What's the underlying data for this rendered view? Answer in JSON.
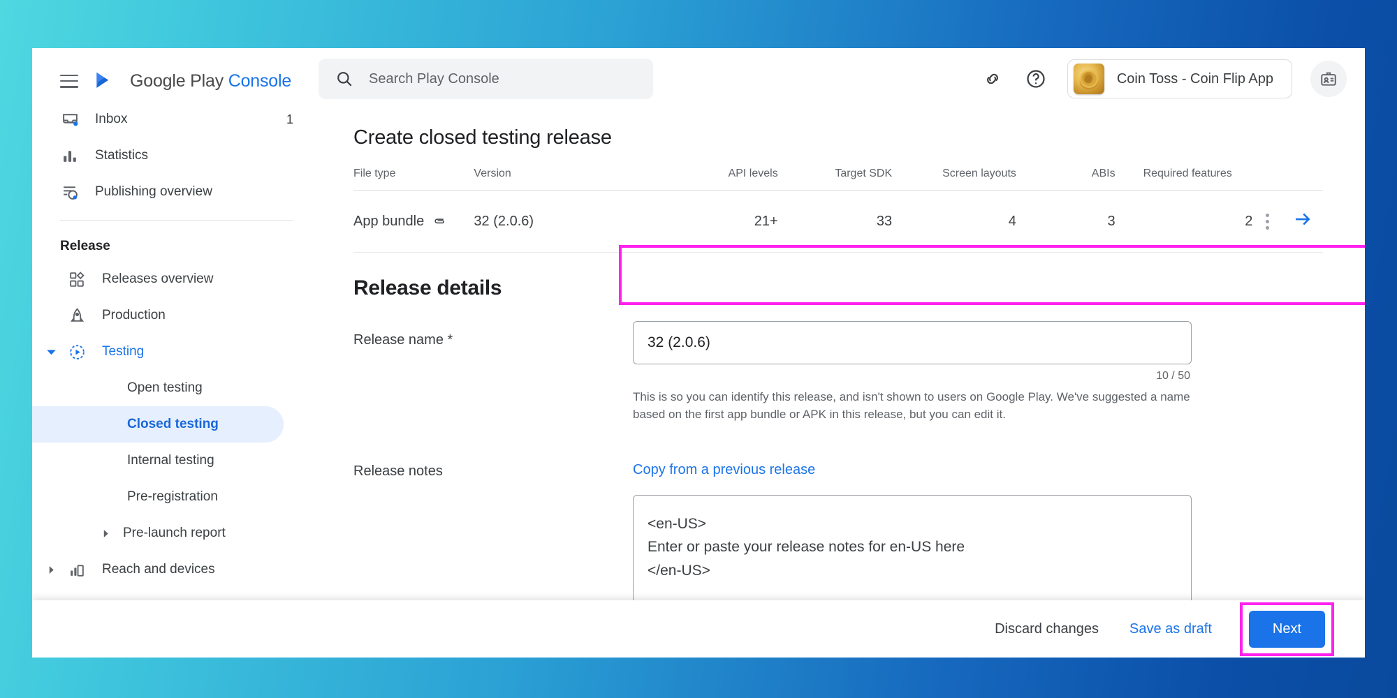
{
  "sidebar": {
    "brand": {
      "part1": "Google Play",
      "part2": "Console",
      "logo_icon": "play-console-logo-icon",
      "menu_icon": "hamburger-menu-icon"
    },
    "top_items": [
      {
        "label": "Inbox",
        "count": "1",
        "icon": "inbox-icon"
      },
      {
        "label": "Statistics",
        "count": "",
        "icon": "bar-chart-icon"
      },
      {
        "label": "Publishing overview",
        "count": "",
        "icon": "publishing-overview-icon"
      }
    ],
    "section_label": "Release",
    "release_items": [
      {
        "label": "Releases overview",
        "icon": "dashboard-grid-icon"
      },
      {
        "label": "Production",
        "icon": "rocket-icon"
      },
      {
        "label": "Testing",
        "icon": "testing-play-icon"
      }
    ],
    "testing_children": [
      {
        "label": "Open testing"
      },
      {
        "label": "Closed testing"
      },
      {
        "label": "Internal testing"
      },
      {
        "label": "Pre-registration"
      },
      {
        "label": "Pre-launch report"
      }
    ],
    "reach_and_devices": {
      "label": "Reach and devices",
      "icon": "reach-devices-chart-icon"
    }
  },
  "topbar": {
    "search": {
      "placeholder": "Search Play Console",
      "value": "",
      "icon": "search-icon"
    },
    "link_icon": "link-icon",
    "help_icon": "help-circle-icon",
    "app_chip": {
      "name": "Coin Toss - Coin Flip App",
      "avatar_icon": "coin-avatar-icon"
    },
    "badge_icon": "id-badge-icon"
  },
  "page": {
    "title": "Create closed testing release"
  },
  "bundle_table": {
    "columns": [
      "File type",
      "Version",
      "API levels",
      "Target SDK",
      "Screen layouts",
      "ABIs",
      "Required features"
    ],
    "rows": [
      {
        "file_type": "App bundle",
        "file_type_icon": "attachment-icon",
        "version": "32 (2.0.6)",
        "api_levels": "21+",
        "target_sdk": "33",
        "screen_layouts": "4",
        "abis": "3",
        "required_features": "2",
        "menu_icon": "kebab-menu-icon",
        "arrow_icon": "arrow-right-icon"
      }
    ]
  },
  "release_details": {
    "heading": "Release details",
    "release_name": {
      "label": "Release name",
      "required_mark": "*",
      "value": "32 (2.0.6)",
      "char_count": "10 / 50",
      "help": "This is so you can identify this release, and isn't shown to users on Google Play. We've suggested a name based on the first app bundle or APK in this release, but you can edit it."
    },
    "release_notes": {
      "label": "Release notes",
      "copy_link": "Copy from a previous release",
      "value": "<en-US>\nEnter or paste your release notes for en-US here\n</en-US>"
    }
  },
  "bottombar": {
    "discard_label": "Discard changes",
    "save_draft_label": "Save as draft",
    "next_label": "Next"
  },
  "colors": {
    "accent_blue": "#1a73e8",
    "highlight_magenta": "#ff22ee",
    "sidebar_selected_bg": "#e5effd"
  }
}
